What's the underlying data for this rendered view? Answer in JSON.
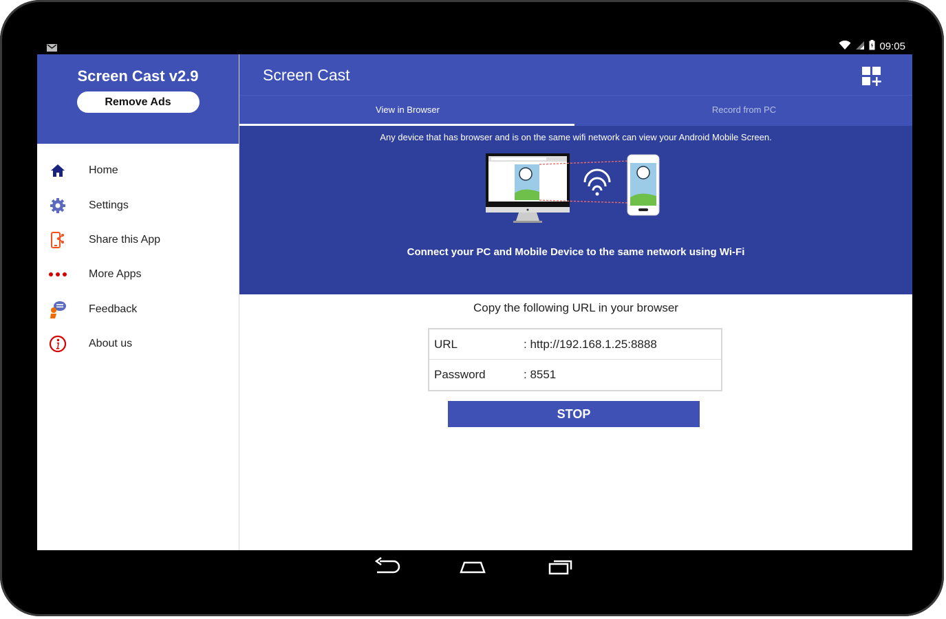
{
  "status_bar": {
    "time": "09:05",
    "left_icon": "gmail-notification-icon",
    "right_icons": [
      "wifi-icon",
      "signal-icon",
      "battery-icon"
    ]
  },
  "drawer": {
    "app_title": "Screen Cast v2.9",
    "remove_ads_label": "Remove Ads",
    "header_color": "#3f51b5",
    "items": [
      {
        "label": "Home",
        "icon": "home-icon",
        "color": "#1a237e"
      },
      {
        "label": "Settings",
        "icon": "gear-icon",
        "color": "#5c6bc0"
      },
      {
        "label": "Share this App",
        "icon": "share-icon",
        "color": "#f4511e"
      },
      {
        "label": "More Apps",
        "icon": "more-dots-icon",
        "color": "#d50000"
      },
      {
        "label": "Feedback",
        "icon": "feedback-icon",
        "color": "#ef6c00"
      },
      {
        "label": "About us",
        "icon": "info-icon",
        "color": "#d50000"
      }
    ]
  },
  "toolbar": {
    "title": "Screen Cast",
    "action_icon": "add-widget-icon"
  },
  "tabs": [
    {
      "label": "View in Browser",
      "active": true
    },
    {
      "label": "Record from PC",
      "active": false
    }
  ],
  "banner": {
    "top_text": "Any device that has browser and is on the same wifi network can view your Android Mobile Screen.",
    "bottom_text": "Connect your PC and Mobile Device to the same network using Wi-Fi",
    "color": "#2f3f9c"
  },
  "connection": {
    "instruction": "Copy the following URL in your browser",
    "rows": [
      {
        "key": "URL",
        "value": ": http://192.168.1.25:8888"
      },
      {
        "key": "Password",
        "value": ": 8551"
      }
    ]
  },
  "stop_label": "STOP",
  "nav_bar": {
    "buttons": [
      "back-icon",
      "home-nav-icon",
      "recents-icon"
    ]
  }
}
